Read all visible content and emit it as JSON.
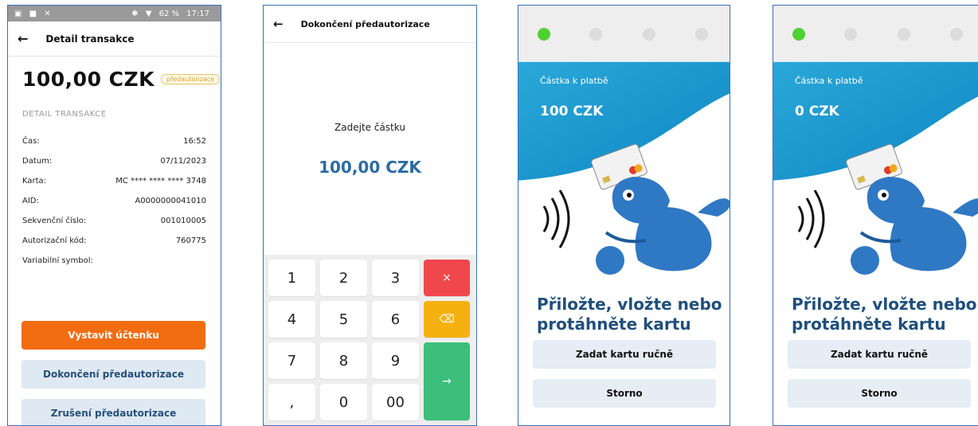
{
  "screen1": {
    "status": {
      "time": "17:17",
      "battery": "62 %"
    },
    "header_title": "Detail transakce",
    "amount": "100,00 CZK",
    "badge": "předautorizace",
    "section_title": "DETAIL TRANSAKCE",
    "details": [
      {
        "label": "Čas:",
        "value": "16:52"
      },
      {
        "label": "Datum:",
        "value": "07/11/2023"
      },
      {
        "label": "Karta:",
        "value": "MC **** **** **** 3748"
      },
      {
        "label": "AID:",
        "value": "A0000000041010"
      },
      {
        "label": "Sekvenční číslo:",
        "value": "001010005"
      },
      {
        "label": "Autorizační kód:",
        "value": "760775"
      },
      {
        "label": "Variabilní symbol:",
        "value": ""
      }
    ],
    "buttons": {
      "receipt": "Vystavit účtenku",
      "complete": "Dokončení předautorizace",
      "cancel": "Zrušení předautorizace"
    }
  },
  "screen2": {
    "header_title": "Dokončení předautorizace",
    "prompt": "Zadejte částku",
    "amount": "100,00 CZK",
    "keys": [
      "1",
      "2",
      "3",
      "4",
      "5",
      "6",
      "7",
      "8",
      "9",
      ",",
      "0",
      "00"
    ],
    "key_clear": "×",
    "key_backspace": "⌫",
    "key_confirm": "→"
  },
  "screen3": {
    "pay_label": "Částka k platbě",
    "pay_amount": "100 CZK",
    "prompt_line1": "Přiložte, vložte nebo",
    "prompt_line2": "protáhněte kartu",
    "btn_manual": "Zadat kartu ručně",
    "btn_cancel": "Storno"
  },
  "screen4": {
    "pay_label": "Částka k platbě",
    "pay_amount": "0 CZK",
    "prompt_line1": "Přiložte, vložte nebo",
    "prompt_line2": "protáhněte kartu",
    "btn_manual": "Zadat kartu ručně",
    "btn_cancel": "Storno"
  },
  "colors": {
    "primary_orange": "#f26c12",
    "button_blue": "#dfe9f3",
    "amount_blue": "#2b6ca3",
    "active_dot": "#4fd133",
    "key_red": "#f0474d",
    "key_yellow": "#f5b10f",
    "key_green": "#3bbf7a"
  }
}
